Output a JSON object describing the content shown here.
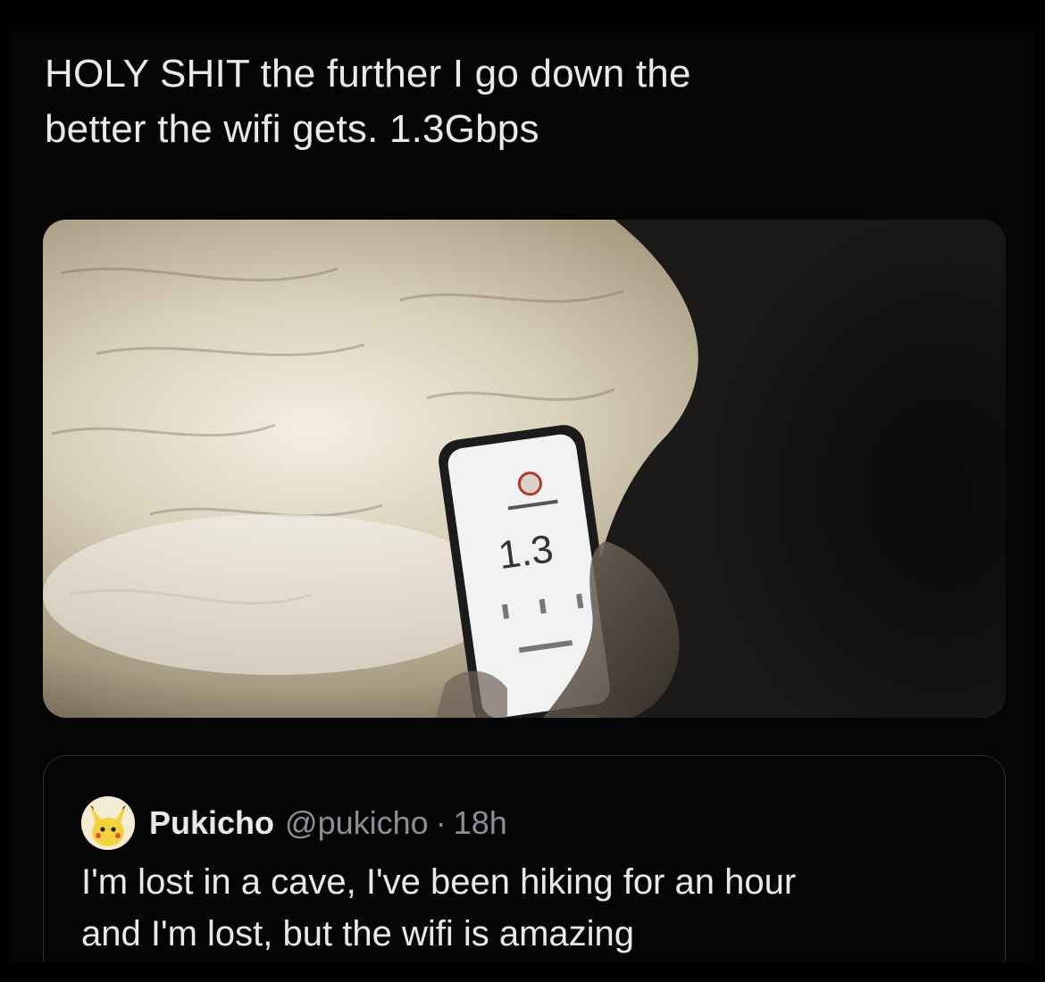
{
  "tweet": {
    "text": "HOLY SHIT the further I go down the\nbetter the wifi gets. 1.3Gbps"
  },
  "media": {
    "screen_reading": "1.3"
  },
  "quoted_tweet": {
    "display_name": "Pukicho",
    "handle": "@pukicho",
    "separator": "·",
    "time": "18h",
    "text": "I'm lost in a cave, I've been hiking for an hour\nand I'm lost, but the wifi is amazing",
    "avatar_icon": "pikachu-avatar-icon"
  },
  "colors": {
    "background": "#000000",
    "text_primary": "#e7e9ea",
    "text_secondary": "#8b9096",
    "card_border": "#2b2b2b"
  }
}
